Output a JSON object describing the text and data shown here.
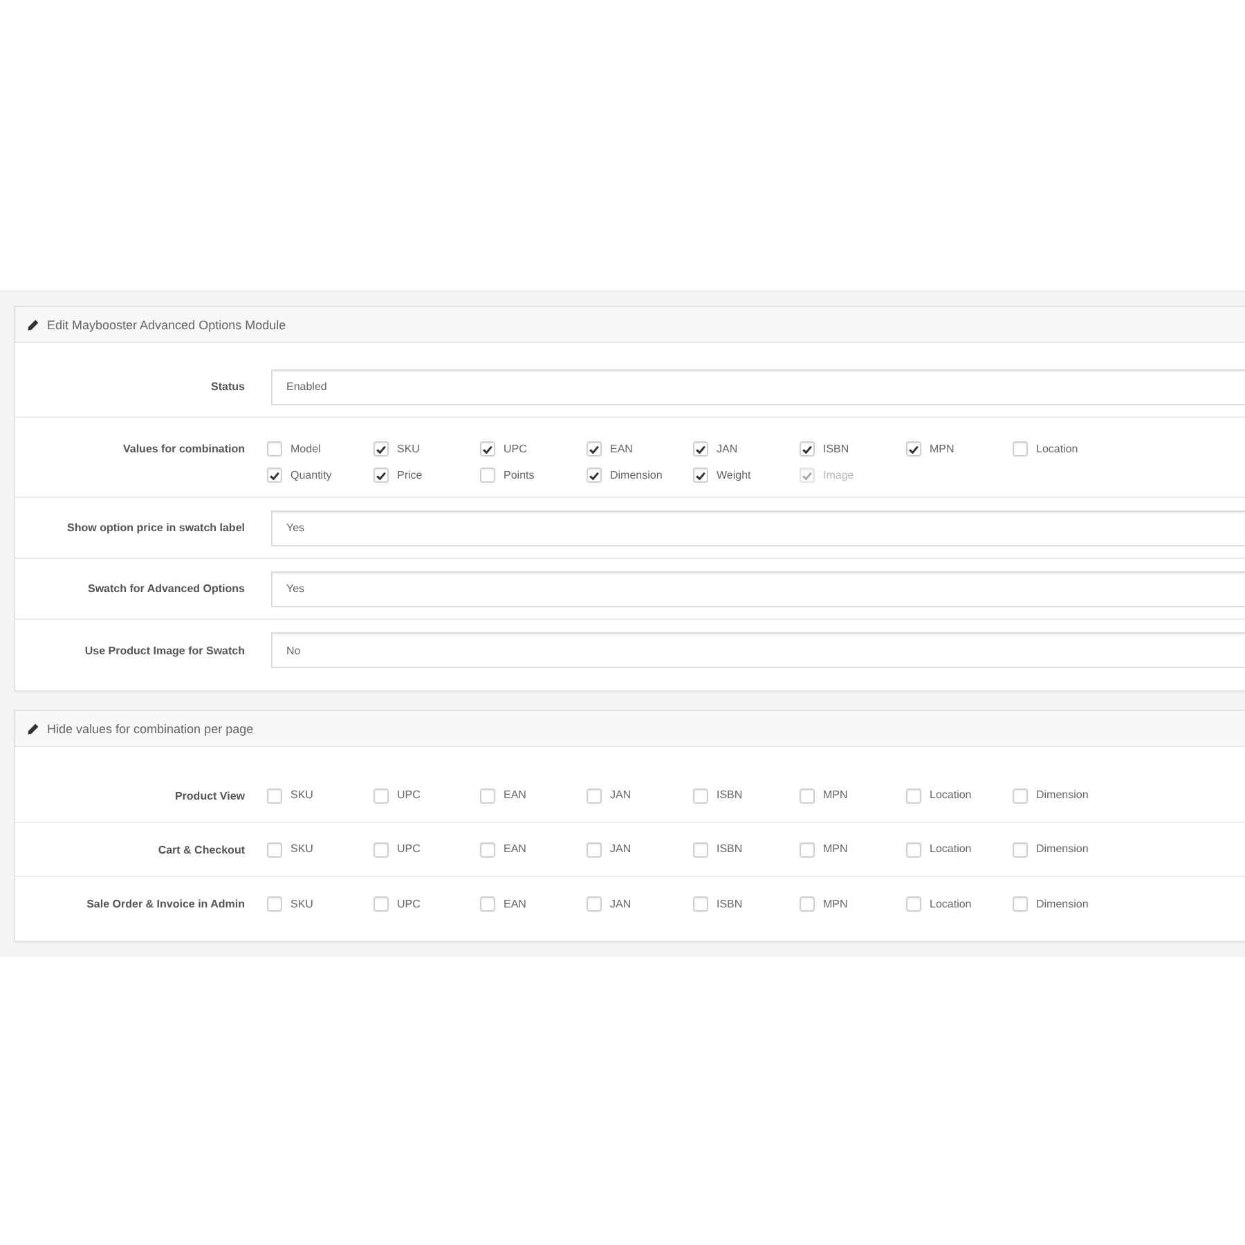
{
  "panels": [
    {
      "title": "Edit Maybooster Advanced Options Module",
      "rows": [
        {
          "kind": "select",
          "label": "Status",
          "value": "Enabled"
        },
        {
          "kind": "checkboxes",
          "label": "Values for combination",
          "options": [
            {
              "label": "Model",
              "checked": false,
              "disabled": false
            },
            {
              "label": "SKU",
              "checked": true,
              "disabled": false
            },
            {
              "label": "UPC",
              "checked": true,
              "disabled": false
            },
            {
              "label": "EAN",
              "checked": true,
              "disabled": false
            },
            {
              "label": "JAN",
              "checked": true,
              "disabled": false
            },
            {
              "label": "ISBN",
              "checked": true,
              "disabled": false
            },
            {
              "label": "MPN",
              "checked": true,
              "disabled": false
            },
            {
              "label": "Location",
              "checked": false,
              "disabled": false
            },
            {
              "label": "Quantity",
              "checked": true,
              "disabled": false
            },
            {
              "label": "Price",
              "checked": true,
              "disabled": false
            },
            {
              "label": "Points",
              "checked": false,
              "disabled": false
            },
            {
              "label": "Dimension",
              "checked": true,
              "disabled": false
            },
            {
              "label": "Weight",
              "checked": true,
              "disabled": false
            },
            {
              "label": "Image",
              "checked": true,
              "disabled": true
            }
          ]
        },
        {
          "kind": "select",
          "label": "Show option price in swatch label",
          "value": "Yes"
        },
        {
          "kind": "select",
          "label": "Swatch for Advanced Options",
          "value": "Yes"
        },
        {
          "kind": "select",
          "label": "Use Product Image for Swatch",
          "value": "No"
        }
      ]
    },
    {
      "title": "Hide values for combination per page",
      "rows": [
        {
          "kind": "checkboxes",
          "label": "Product View",
          "options": [
            {
              "label": "SKU",
              "checked": false,
              "disabled": false
            },
            {
              "label": "UPC",
              "checked": false,
              "disabled": false
            },
            {
              "label": "EAN",
              "checked": false,
              "disabled": false
            },
            {
              "label": "JAN",
              "checked": false,
              "disabled": false
            },
            {
              "label": "ISBN",
              "checked": false,
              "disabled": false
            },
            {
              "label": "MPN",
              "checked": false,
              "disabled": false
            },
            {
              "label": "Location",
              "checked": false,
              "disabled": false
            },
            {
              "label": "Dimension",
              "checked": false,
              "disabled": false
            }
          ]
        },
        {
          "kind": "checkboxes",
          "label": "Cart & Checkout",
          "options": [
            {
              "label": "SKU",
              "checked": false,
              "disabled": false
            },
            {
              "label": "UPC",
              "checked": false,
              "disabled": false
            },
            {
              "label": "EAN",
              "checked": false,
              "disabled": false
            },
            {
              "label": "JAN",
              "checked": false,
              "disabled": false
            },
            {
              "label": "ISBN",
              "checked": false,
              "disabled": false
            },
            {
              "label": "MPN",
              "checked": false,
              "disabled": false
            },
            {
              "label": "Location",
              "checked": false,
              "disabled": false
            },
            {
              "label": "Dimension",
              "checked": false,
              "disabled": false
            }
          ]
        },
        {
          "kind": "checkboxes",
          "label": "Sale Order & Invoice in Admin",
          "options": [
            {
              "label": "SKU",
              "checked": false,
              "disabled": false
            },
            {
              "label": "UPC",
              "checked": false,
              "disabled": false
            },
            {
              "label": "EAN",
              "checked": false,
              "disabled": false
            },
            {
              "label": "JAN",
              "checked": false,
              "disabled": false
            },
            {
              "label": "ISBN",
              "checked": false,
              "disabled": false
            },
            {
              "label": "MPN",
              "checked": false,
              "disabled": false
            },
            {
              "label": "Location",
              "checked": false,
              "disabled": false
            },
            {
              "label": "Dimension",
              "checked": false,
              "disabled": false
            }
          ]
        }
      ]
    }
  ]
}
